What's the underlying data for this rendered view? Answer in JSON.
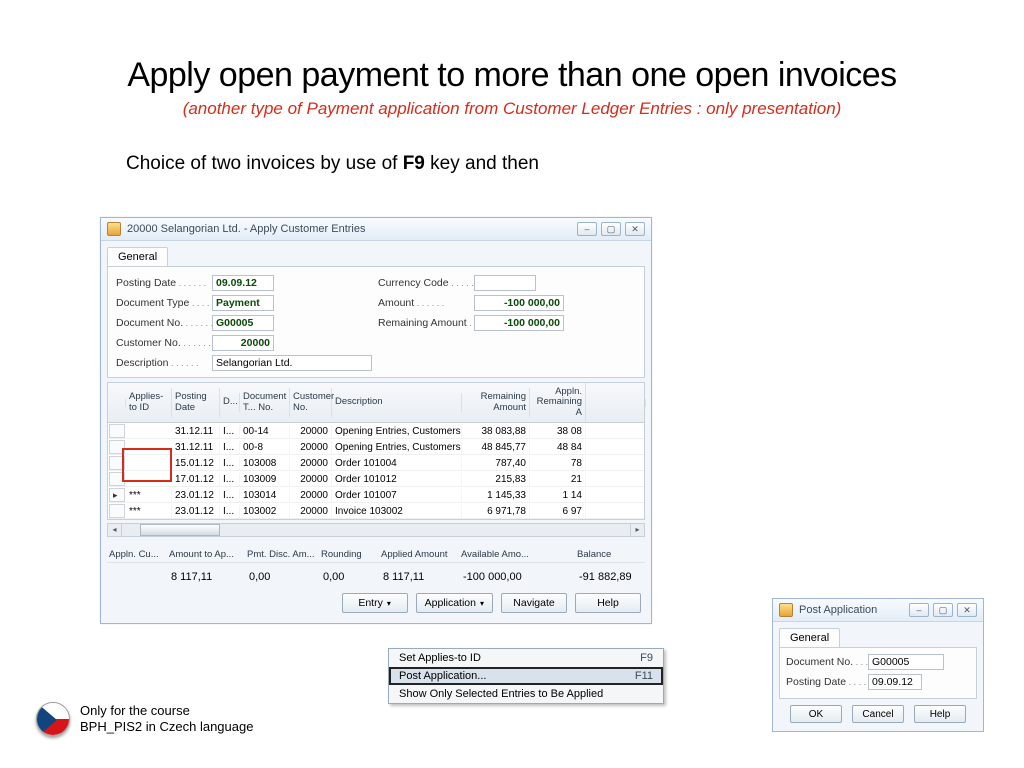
{
  "slide": {
    "title": "Apply open payment to more than one open invoices",
    "subtitle": "(another type of Payment application from  Customer Ledger Entries  : only presentation)",
    "choice_prefix": "Choice of two invoices by use of ",
    "choice_key": "F9",
    "choice_suffix": " key and then"
  },
  "footer": {
    "line1": "Only for the course",
    "line2": "BPH_PIS2 in Czech language"
  },
  "main_window": {
    "title": "20000 Selangorian Ltd. - Apply Customer Entries",
    "tab": "General",
    "fields": {
      "posting_date": {
        "label": "Posting Date",
        "value": "09.09.12"
      },
      "document_type": {
        "label": "Document Type",
        "value": "Payment"
      },
      "document_no": {
        "label": "Document No.",
        "value": "G00005"
      },
      "customer_no": {
        "label": "Customer No.",
        "value": "20000"
      },
      "description": {
        "label": "Description",
        "value": "Selangorian Ltd."
      },
      "currency_code": {
        "label": "Currency Code",
        "value": ""
      },
      "amount": {
        "label": "Amount",
        "value": "-100 000,00"
      },
      "remaining_amount": {
        "label": "Remaining Amount",
        "value": "-100 000,00"
      }
    },
    "grid": {
      "headers": [
        "",
        "Applies-to ID",
        "Posting Date",
        "D...",
        "Document T... No.",
        "Customer No.",
        "Description",
        "Remaining Amount",
        "Appln. Remaining A"
      ],
      "rows": [
        {
          "applies_id": "",
          "date": "31.12.11",
          "dtype": "I...",
          "dno": "00-14",
          "cust": "20000",
          "desc": "Opening Entries, Customers",
          "remain": "38 083,88",
          "appln": "38 08"
        },
        {
          "applies_id": "",
          "date": "31.12.11",
          "dtype": "I...",
          "dno": "00-8",
          "cust": "20000",
          "desc": "Opening Entries, Customers",
          "remain": "48 845,77",
          "appln": "48 84"
        },
        {
          "applies_id": "",
          "date": "15.01.12",
          "dtype": "I...",
          "dno": "103008",
          "cust": "20000",
          "desc": "Order 101004",
          "remain": "787,40",
          "appln": "78"
        },
        {
          "applies_id": "",
          "date": "17.01.12",
          "dtype": "I...",
          "dno": "103009",
          "cust": "20000",
          "desc": "Order 101012",
          "remain": "215,83",
          "appln": "21"
        },
        {
          "applies_id": "***",
          "date": "23.01.12",
          "dtype": "I...",
          "dno": "103014",
          "cust": "20000",
          "desc": "Order 101007",
          "remain": "1 145,33",
          "appln": "1 14",
          "ptr": true
        },
        {
          "applies_id": "***",
          "date": "23.01.12",
          "dtype": "I...",
          "dno": "103002",
          "cust": "20000",
          "desc": "Invoice 103002",
          "remain": "6 971,78",
          "appln": "6 97"
        }
      ]
    },
    "summary": {
      "headers": [
        "Appln. Cu...",
        "Amount to Ap...",
        "Pmt. Disc. Am...",
        "Rounding",
        "Applied Amount",
        "Available Amo...",
        "",
        "Balance"
      ],
      "values": [
        "",
        "8 117,11",
        "0,00",
        "0,00",
        "8 117,11",
        "-100 000,00",
        "",
        "-91 882,89"
      ]
    },
    "buttons": {
      "entry": "Entry",
      "application": "Application",
      "navigate": "Navigate",
      "help": "Help"
    }
  },
  "context_menu": {
    "items": [
      {
        "label": "Set Applies-to ID",
        "key": "F9"
      },
      {
        "label": "Post Application...",
        "key": "F11",
        "highlight": true
      },
      {
        "label": "Show Only Selected Entries to Be Applied",
        "key": ""
      }
    ]
  },
  "post_window": {
    "title": "Post Application",
    "tab": "General",
    "fields": {
      "document_no": {
        "label": "Document No.",
        "value": "G00005"
      },
      "posting_date": {
        "label": "Posting Date",
        "value": "09.09.12"
      }
    },
    "buttons": {
      "ok": "OK",
      "cancel": "Cancel",
      "help": "Help"
    }
  }
}
